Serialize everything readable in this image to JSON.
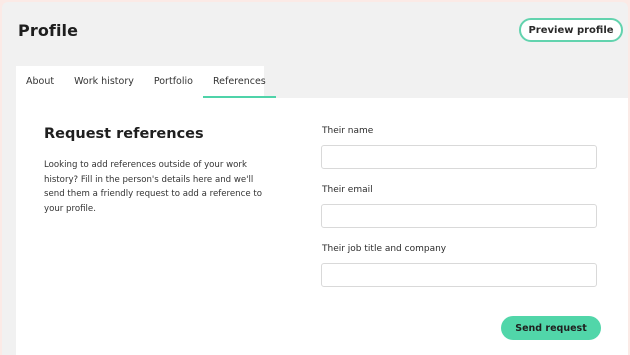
{
  "header": {
    "title": "Profile",
    "preview_button": "Preview profile"
  },
  "tabs": [
    {
      "label": "About",
      "active": false
    },
    {
      "label": "Work history",
      "active": false
    },
    {
      "label": "Portfolio",
      "active": false
    },
    {
      "label": "References",
      "active": true
    }
  ],
  "section": {
    "heading": "Request references",
    "description": "Looking to add references outside of your work history? Fill in the person's details here and we'll send them a friendly request to add a reference to your profile."
  },
  "form": {
    "name_label": "Their name",
    "name_value": "",
    "email_label": "Their email",
    "email_value": "",
    "job_label": "Their job title and company",
    "job_value": "",
    "submit_label": "Send request"
  },
  "colors": {
    "accent": "#51d6a9",
    "page_background": "#fbeae6",
    "header_background": "#f1f1f1"
  }
}
